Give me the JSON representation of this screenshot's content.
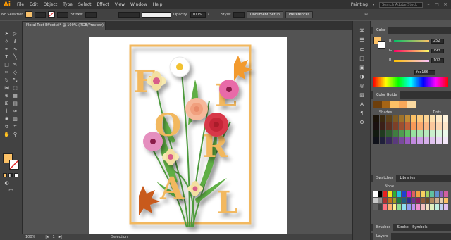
{
  "app": {
    "logo": "Ai"
  },
  "menu": [
    "File",
    "Edit",
    "Object",
    "Type",
    "Select",
    "Effect",
    "View",
    "Window",
    "Help"
  ],
  "menu_right": {
    "workspace": "Painting",
    "search_placeholder": "Search Adobe Stock"
  },
  "control_bar": {
    "selection_label": "No Selection",
    "stroke_label": "Stroke:",
    "opacity_label": "Opacity:",
    "opacity_value": "100%",
    "style_label": "Style:",
    "document_setup": "Document Setup",
    "preferences": "Preferences",
    "fill_color": "#f7c06b"
  },
  "document": {
    "tab_title": "Floral Text Effect.ai* @ 100% (RGB/Preview)"
  },
  "artwork": {
    "letters": [
      "F",
      "L",
      "O",
      "R",
      "A",
      "L"
    ],
    "letter_color": "#f2b85e",
    "frame_color": "#f2b85e"
  },
  "status_bar": {
    "zoom": "100%",
    "page": "1",
    "tool": "Selection"
  },
  "color_panel": {
    "tab": "Color",
    "r_label": "R",
    "r_value": "252",
    "g_label": "G",
    "g_value": "193",
    "b_label": "B",
    "b_value": "102",
    "hex": "fcc166"
  },
  "color_guide": {
    "tab": "Color Guide",
    "shades": "Shades",
    "tints": "Tints"
  },
  "swatches": {
    "tabs": [
      "Swatches",
      "Libraries"
    ],
    "none_label": "None"
  },
  "brushes": {
    "tabs": [
      "Brushes",
      "Stroke",
      "Symbols"
    ]
  },
  "layers": {
    "tab": "Layers"
  }
}
